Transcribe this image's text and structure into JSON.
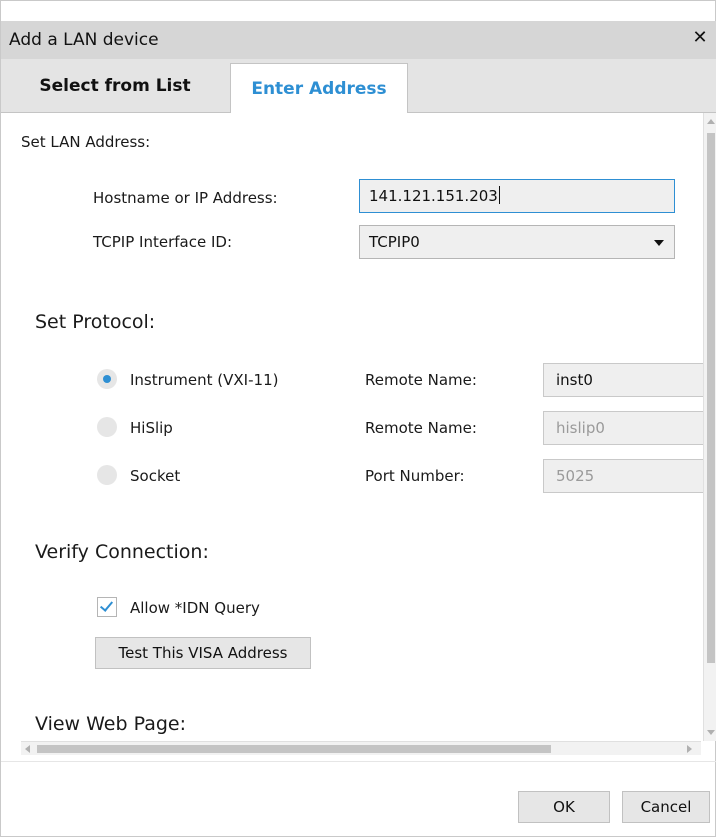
{
  "dialog": {
    "title": "Add a LAN device",
    "close_icon": "close-icon",
    "close_glyph": "✕"
  },
  "tabs": [
    {
      "label": "Select from List",
      "active": false
    },
    {
      "label": "Enter Address",
      "active": true
    }
  ],
  "lan_address": {
    "heading": "Set LAN Address:",
    "hostname_label": "Hostname or IP Address:",
    "hostname_value": "141.121.151.203",
    "interface_label": "TCPIP Interface ID:",
    "interface_value": "TCPIP0"
  },
  "protocol": {
    "heading": "Set Protocol:",
    "options": [
      {
        "label": "Instrument (VXI-11)",
        "selected": true,
        "field_label": "Remote Name:",
        "field_value": "inst0",
        "enabled": true
      },
      {
        "label": "HiSlip",
        "selected": false,
        "field_label": "Remote Name:",
        "field_value": "hislip0",
        "enabled": false
      },
      {
        "label": "Socket",
        "selected": false,
        "field_label": "Port Number:",
        "field_value": "5025",
        "enabled": false
      }
    ]
  },
  "verify": {
    "heading": "Verify Connection:",
    "idn_label": "Allow *IDN Query",
    "idn_checked": true,
    "test_button": "Test This VISA Address"
  },
  "web_page": {
    "heading": "View Web Page:"
  },
  "footer": {
    "ok_label": "OK",
    "cancel_label": "Cancel"
  },
  "colors": {
    "accent": "#2e8fd3",
    "titlebar": "#d6d6d6",
    "tabbar": "#e4e4e4"
  }
}
